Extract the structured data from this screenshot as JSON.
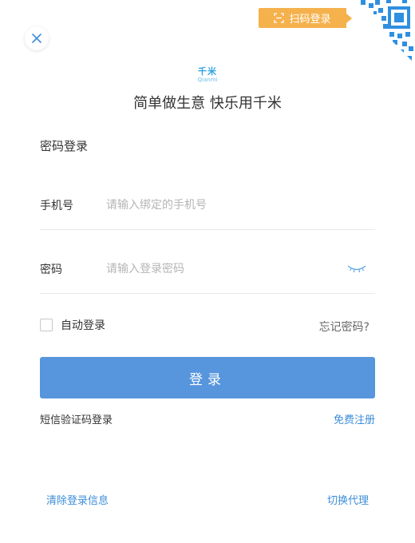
{
  "qr_tag": {
    "label": "扫码登录",
    "icon": "scan-icon"
  },
  "close": {
    "icon": "close-icon"
  },
  "logo": {
    "cn": "千米",
    "en": "Qianmi"
  },
  "slogan": "简单做生意 快乐用千米",
  "form": {
    "title": "密码登录",
    "phone": {
      "label": "手机号",
      "placeholder": "请输入绑定的手机号",
      "value": ""
    },
    "password": {
      "label": "密码",
      "placeholder": "请输入登录密码",
      "value": "",
      "toggle_icon": "eye-closed-icon"
    },
    "auto_login": {
      "label": "自动登录",
      "checked": false
    },
    "forgot_label": "忘记密码?",
    "submit_label": "登录"
  },
  "links": {
    "sms_login": "短信验证码登录",
    "register": "免费注册",
    "clear_info": "清除登录信息",
    "switch_proxy": "切换代理"
  },
  "colors": {
    "primary": "#5795dd",
    "link": "#3d8ed8",
    "qr_tag": "#f5b14c",
    "qr_pattern": "#2f8fe0",
    "logo": "#2ea3e0"
  }
}
